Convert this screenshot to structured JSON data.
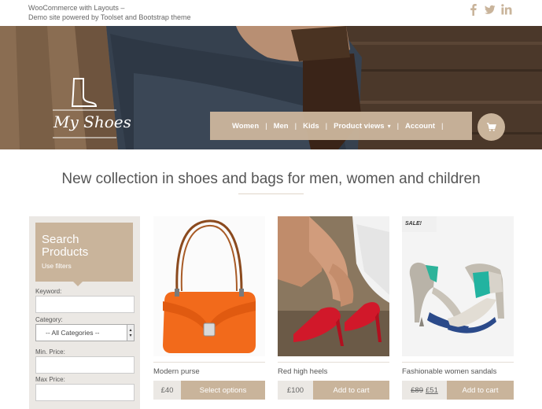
{
  "site": {
    "tagline_line1": "WooCommerce with Layouts –",
    "tagline_line2": "Demo site powered by Toolset and Bootstrap theme",
    "social": [
      "facebook-icon",
      "twitter-icon",
      "linkedin-icon"
    ],
    "logo_text": "My Shoes"
  },
  "nav": {
    "items": [
      {
        "label": "Women"
      },
      {
        "label": "Men"
      },
      {
        "label": "Kids"
      },
      {
        "label": "Product views"
      },
      {
        "label": "Account"
      }
    ]
  },
  "headline": "New collection in shoes and bags for men, women and children",
  "sidebar": {
    "title_line1": "Search",
    "title_line2": "Products",
    "subtitle": "Use filters",
    "keyword_label": "Keyword:",
    "category_label": "Category:",
    "category_value": "-- All Categories --",
    "min_price_label": "Min. Price:",
    "max_price_label": "Max Price:"
  },
  "products": [
    {
      "name": "Modern purse",
      "price": "£40",
      "button": "Select options"
    },
    {
      "name": "Red high heels",
      "price": "£100",
      "button": "Add to cart"
    },
    {
      "name": "Fashionable women sandals",
      "old_price": "£89",
      "price": "£51",
      "button": "Add to cart",
      "badge": "SALE!"
    }
  ],
  "colors": {
    "accent": "#c9b49b",
    "panel": "#ebe8e4"
  }
}
